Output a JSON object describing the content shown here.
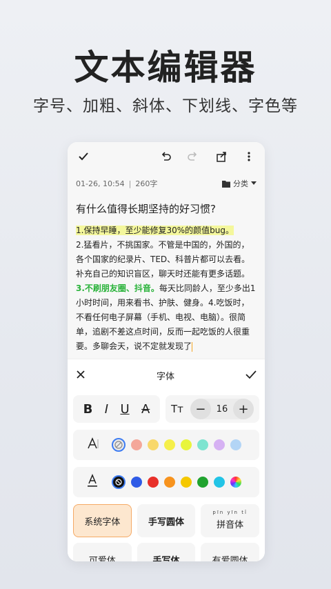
{
  "promo": {
    "headline": "文本编辑器",
    "subline": "字号、加粗、斜体、下划线、字色等"
  },
  "toolbar": {
    "icons": [
      "check-icon",
      "undo-icon",
      "redo-icon",
      "share-icon",
      "more-icon"
    ]
  },
  "note": {
    "date": "01-26, 10:54",
    "separator": "|",
    "word_count": "260字",
    "category_label": "分类",
    "title": "有什么值得长期坚持的好习惯?",
    "p1_highlight": "1.保持早睡，至少能修复30%的颜值bug。",
    "p2": "2.猛看片，不挑国家。不管是中国的，外国的，各个国家的纪录片、TED、科普片都可以去看。补充自己的知识盲区，聊天时还能有更多话题。",
    "p3_green": "3.不刷朋友圈、抖音。",
    "p3_rest": "每天比同龄人，至少多出1小时时间，用来看书、护肤、健身。4.吃饭时，不看任何电子屏幕（手机、电视、电脑）。很简单，追剧不差这点时间，反而一起吃饭的人很重要。多聊会天，说不定就发现了"
  },
  "panel": {
    "title": "字体",
    "format_buttons": [
      "B",
      "I",
      "U",
      "A"
    ],
    "size_icon": "Tт",
    "size_minus": "−",
    "size_value": "16",
    "size_plus": "+",
    "highlight_colors": [
      "#f4a79a",
      "#f8d86b",
      "#f5ef4a",
      "#e8f53c",
      "#7ee4d0",
      "#d6b1f3",
      "#b3d5f6"
    ],
    "text_colors": [
      "#2f5be6",
      "#e8302a",
      "#f7931e",
      "#f5c800",
      "#21a32f",
      "#22c4e6"
    ],
    "fonts": [
      "系统字体",
      "手写圆体",
      "拼音体",
      "可爱体",
      "手写体",
      "有爱圆体"
    ],
    "pinyin_hint": "pīn yīn tǐ",
    "accent_color": "#3d7cf2"
  }
}
